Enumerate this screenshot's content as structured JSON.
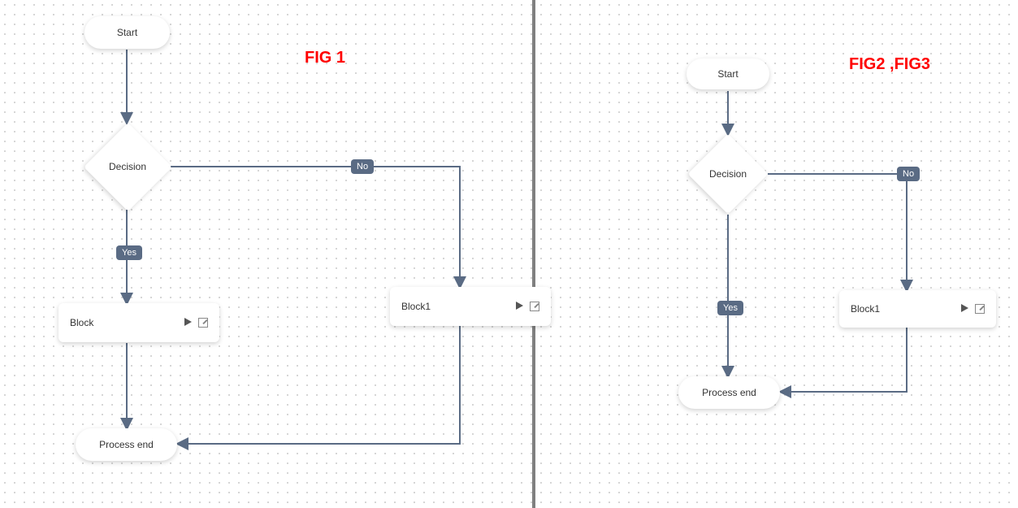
{
  "fig1": {
    "label": "FIG 1",
    "start": "Start",
    "decision": "Decision",
    "yes": "Yes",
    "no": "No",
    "block": "Block",
    "block1": "Block1",
    "end": "Process end"
  },
  "fig2": {
    "label": "FIG2 ,FIG3",
    "start": "Start",
    "decision": "Decision",
    "yes": "Yes",
    "no": "No",
    "block1": "Block1",
    "end": "Process end"
  }
}
